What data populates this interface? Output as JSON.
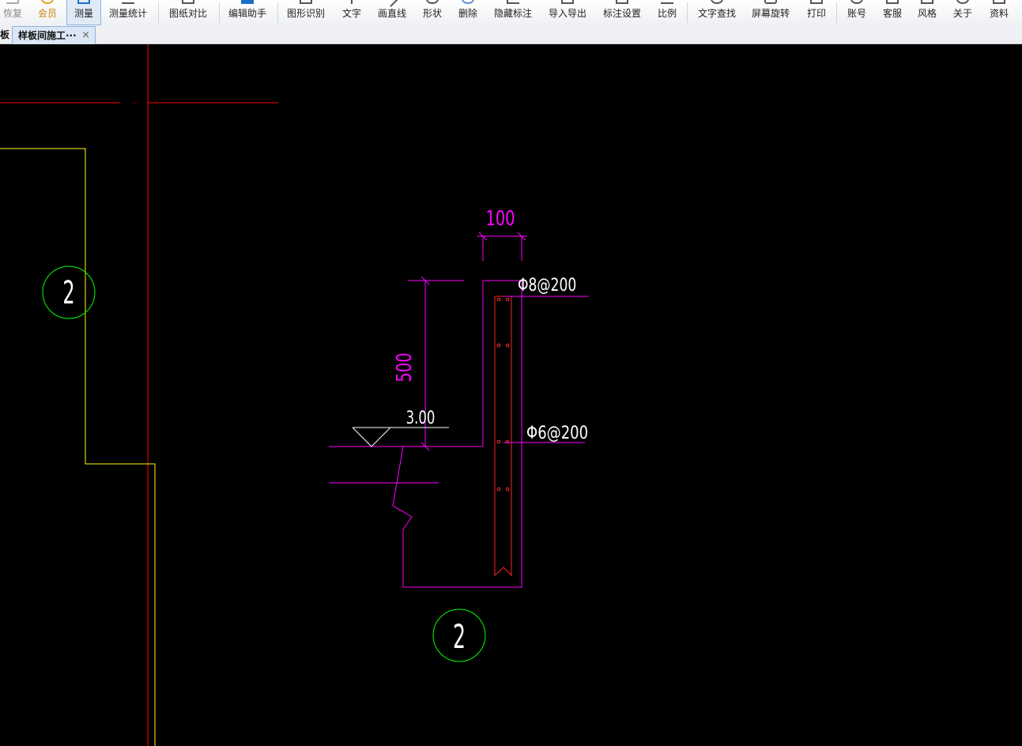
{
  "toolbar": {
    "items": [
      {
        "label": "恢复",
        "icon": "redo-icon"
      },
      {
        "label": "会员",
        "icon": "vip-icon"
      },
      {
        "label": "测量",
        "icon": "measure-icon"
      },
      {
        "label": "测量统计",
        "icon": "measure-stats-icon"
      },
      {
        "label": "图纸对比",
        "icon": "compare-icon"
      },
      {
        "label": "编辑助手",
        "icon": "edit-assistant-icon"
      },
      {
        "label": "图形识别",
        "icon": "shape-recognition-icon"
      },
      {
        "label": "文字",
        "icon": "text-icon"
      },
      {
        "label": "画直线",
        "icon": "line-icon"
      },
      {
        "label": "形状",
        "icon": "shape-icon"
      },
      {
        "label": "删除",
        "icon": "delete-icon"
      },
      {
        "label": "隐藏标注",
        "icon": "hide-annotation-icon"
      },
      {
        "label": "导入导出",
        "icon": "import-export-icon"
      },
      {
        "label": "标注设置",
        "icon": "annotation-settings-icon"
      },
      {
        "label": "比例",
        "icon": "scale-icon"
      },
      {
        "label": "文字查找",
        "icon": "text-search-icon"
      },
      {
        "label": "屏幕旋转",
        "icon": "rotate-screen-icon"
      },
      {
        "label": "打印",
        "icon": "print-icon"
      },
      {
        "label": "账号",
        "icon": "account-icon"
      },
      {
        "label": "客服",
        "icon": "customer-service-icon"
      },
      {
        "label": "风格",
        "icon": "style-icon"
      },
      {
        "label": "关于",
        "icon": "about-icon"
      },
      {
        "label": "资料",
        "icon": "resources-icon"
      }
    ],
    "accent_color": "#1a6fc9"
  },
  "tabs": [
    {
      "label": "板"
    },
    {
      "label": "样板间施工···",
      "close": "×"
    }
  ],
  "drawing": {
    "dim_top": "100",
    "dim_side": "500",
    "elevation": "3.00",
    "rebar_top": "Φ8@200",
    "rebar_mid": "Φ6@200",
    "axis_left": "2",
    "detail_label": "2",
    "colors": {
      "background": "#000000",
      "section": "#ff00ff",
      "axis": "#ff0000",
      "wall": "#ffff00",
      "bubble": "#00ff00",
      "text": "#ffffff"
    }
  }
}
